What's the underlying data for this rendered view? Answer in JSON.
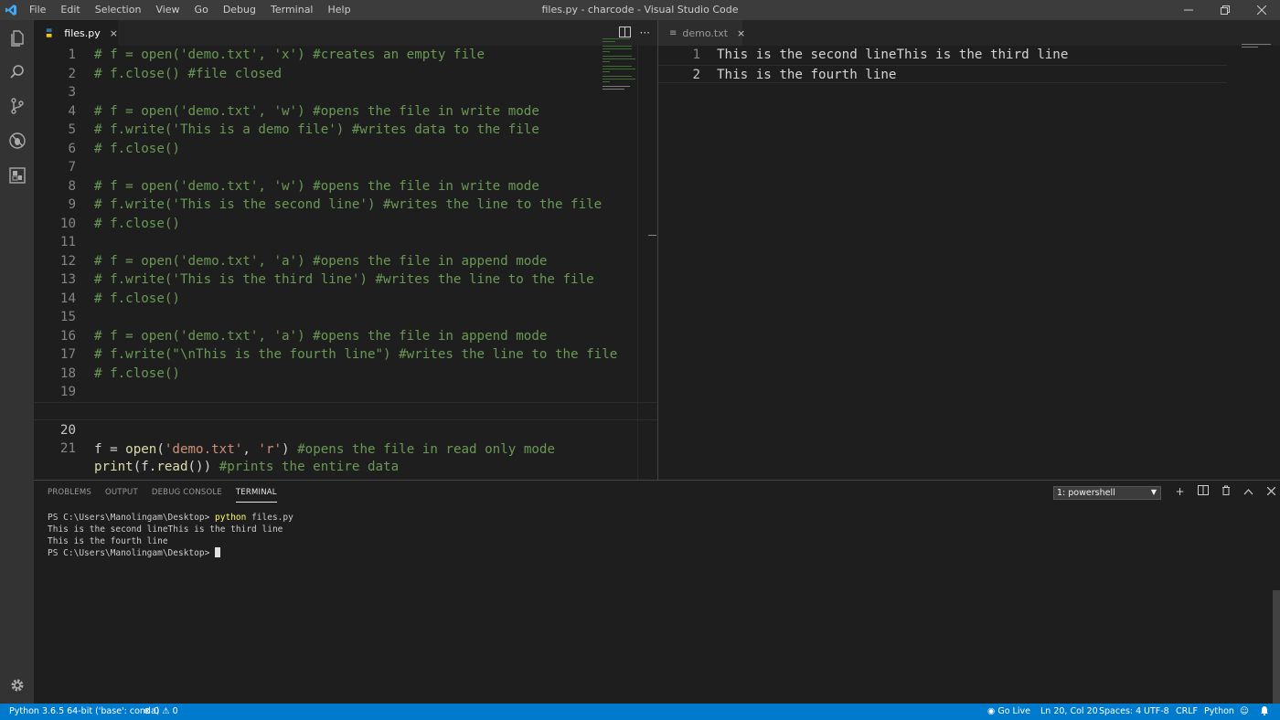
{
  "window": {
    "title": "files.py - charcode - Visual Studio Code"
  },
  "menu": [
    "File",
    "Edit",
    "Selection",
    "View",
    "Go",
    "Debug",
    "Terminal",
    "Help"
  ],
  "colors": {
    "accent": "#007acc",
    "comment": "#6a9955",
    "string": "#ce9178",
    "function": "#dcdcaa"
  },
  "activity_icons": [
    "explorer-icon",
    "search-icon",
    "source-control-icon",
    "debug-icon",
    "extensions-icon",
    "gear-icon"
  ],
  "left_editor": {
    "tab": {
      "label": "files.py",
      "close": "×"
    },
    "lines": [
      {
        "n": "1",
        "text": "# f = open('demo.txt', 'x') #creates an empty file"
      },
      {
        "n": "2",
        "text": "# f.close() #file closed"
      },
      {
        "n": "3",
        "text": ""
      },
      {
        "n": "4",
        "text": "# f = open('demo.txt', 'w') #opens the file in write mode"
      },
      {
        "n": "5",
        "text": "# f.write('This is a demo file') #writes data to the file"
      },
      {
        "n": "6",
        "text": "# f.close()"
      },
      {
        "n": "7",
        "text": ""
      },
      {
        "n": "8",
        "text": "# f = open('demo.txt', 'w') #opens the file in write mode"
      },
      {
        "n": "9",
        "text": "# f.write('This is the second line') #writes the line to the file"
      },
      {
        "n": "10",
        "text": "# f.close()"
      },
      {
        "n": "11",
        "text": ""
      },
      {
        "n": "12",
        "text": "# f = open('demo.txt', 'a') #opens the file in append mode"
      },
      {
        "n": "13",
        "text": "# f.write('This is the third line') #writes the line to the file"
      },
      {
        "n": "14",
        "text": "# f.close()"
      },
      {
        "n": "15",
        "text": ""
      },
      {
        "n": "16",
        "text": "# f = open('demo.txt', 'a') #opens the file in append mode"
      },
      {
        "n": "17",
        "text": "# f.write(\"\\nThis is the fourth line\") #writes the line to the file"
      },
      {
        "n": "18",
        "text": "# f.close()"
      },
      {
        "n": "19",
        "text": ""
      }
    ],
    "line20": {
      "n": "20",
      "a": "f = ",
      "b": "open",
      "c": "(",
      "d": "'demo.txt'",
      "e": ", ",
      "f": "'r'",
      "g": ") ",
      "h": "#opens the file in read only mode"
    },
    "line21": {
      "n": "21",
      "a": "print",
      "b": "(f.",
      "c": "read",
      "d": "()) ",
      "e": "#prints the entire data"
    }
  },
  "right_editor": {
    "tab": {
      "label": "demo.txt",
      "close": "×"
    },
    "lines": [
      {
        "n": "1",
        "text": "This is the second lineThis is the third line"
      },
      {
        "n": "2",
        "text": "This is the fourth line"
      }
    ]
  },
  "panel": {
    "tabs": [
      "PROBLEMS",
      "OUTPUT",
      "DEBUG CONSOLE",
      "TERMINAL"
    ],
    "active_tab": "TERMINAL",
    "terminal_select": "1: powershell",
    "terminal": {
      "prompt1": "PS C:\\Users\\Manolingam\\Desktop> ",
      "cmd": "python",
      "arg": " files.py",
      "out1": "This is the second lineThis is the third line",
      "out2": "This is the fourth line",
      "prompt2": "PS C:\\Users\\Manolingam\\Desktop> "
    }
  },
  "status": {
    "python": "Python 3.6.5 64-bit ('base': conda)",
    "errors": "0",
    "warnings": "0",
    "golive": "Go Live",
    "position": "Ln 20, Col 20",
    "spaces": "Spaces: 4",
    "encoding": "UTF-8",
    "eol": "CRLF",
    "language": "Python"
  }
}
